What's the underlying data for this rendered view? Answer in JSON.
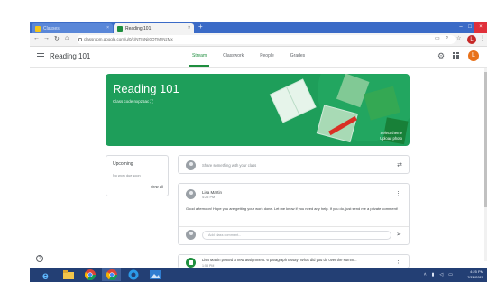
{
  "browser": {
    "tabs": [
      {
        "label": "Classes",
        "active": false
      },
      {
        "label": "Reading 101",
        "active": true
      }
    ],
    "new_tab": "+",
    "url": "classroom.google.com/u/0/c/NTI5NjI0OTMzNzMx",
    "window_controls": {
      "minimize": "–",
      "maximize": "□",
      "close": "×"
    },
    "profile_initial": "L"
  },
  "header": {
    "class_title": "Reading 101",
    "tabs": [
      "Stream",
      "Classwork",
      "People",
      "Grades"
    ],
    "active_tab": "Stream",
    "avatar_initial": "L"
  },
  "banner": {
    "title": "Reading 101",
    "class_code_label": "Class code  nxpz5ac ⛶",
    "select_theme": "Select theme",
    "upload_photo": "Upload photo"
  },
  "upcoming": {
    "title": "Upcoming",
    "subtitle": "No work due soon",
    "view_all": "View all"
  },
  "share": {
    "placeholder": "Share something with your class"
  },
  "post": {
    "author": "Lisa Martin",
    "time": "4:25 PM",
    "body": "Good afternoon! Hope you are getting your work done. Let me know if you need any help. If you do, just send me a private comment!",
    "comment_placeholder": "Add class comment..."
  },
  "assignment": {
    "text": "Lisa Martin posted a new assignment: 6 paragraph Essay: What did you do over the summ...",
    "time": "1:58 PM"
  },
  "help": "?",
  "taskbar": {
    "time": "4:25 PM",
    "date": "7/22/2020"
  },
  "colors": {
    "accent": "#1e8e3e",
    "banner": "#1e9e5a",
    "chrome_tabs": "#3b6bc7",
    "taskbar": "#233f74"
  },
  "icons": [
    "menu-icon",
    "gear-icon",
    "apps-grid-icon",
    "repost-icon",
    "more-vert-icon",
    "send-icon",
    "assignment-icon",
    "help-icon"
  ]
}
